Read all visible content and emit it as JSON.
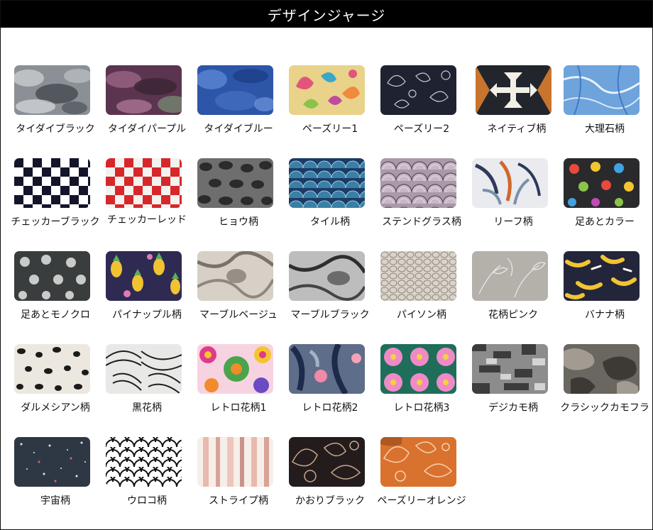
{
  "header": {
    "title": "デザインジャージ"
  },
  "swatches": [
    {
      "label": "タイダイブラック",
      "icon": "tie-dye-black-pattern"
    },
    {
      "label": "タイダイパープル",
      "icon": "tie-dye-purple-pattern"
    },
    {
      "label": "タイダイブルー",
      "icon": "tie-dye-blue-pattern"
    },
    {
      "label": "ペーズリー1",
      "icon": "paisley-1-pattern"
    },
    {
      "label": "ペーズリー2",
      "icon": "paisley-2-pattern"
    },
    {
      "label": "ネイティブ柄",
      "icon": "native-pattern"
    },
    {
      "label": "大理石柄",
      "icon": "marble-blue-pattern"
    },
    {
      "label": "チェッカーブラック",
      "icon": "checker-black-pattern"
    },
    {
      "label": "チェッカーレッド",
      "icon": "checker-red-pattern"
    },
    {
      "label": "ヒョウ柄",
      "icon": "leopard-pattern"
    },
    {
      "label": "タイル柄",
      "icon": "tile-pattern"
    },
    {
      "label": "ステンドグラス柄",
      "icon": "stained-glass-pattern"
    },
    {
      "label": "リーフ柄",
      "icon": "leaf-pattern"
    },
    {
      "label": "足あとカラー",
      "icon": "paw-color-pattern"
    },
    {
      "label": "足あとモノクロ",
      "icon": "paw-mono-pattern"
    },
    {
      "label": "パイナップル柄",
      "icon": "pineapple-pattern"
    },
    {
      "label": "マーブルベージュ",
      "icon": "marble-beige-pattern"
    },
    {
      "label": "マーブルブラック",
      "icon": "marble-black-pattern"
    },
    {
      "label": "パイソン柄",
      "icon": "python-pattern"
    },
    {
      "label": "花柄ピンク",
      "icon": "floral-pink-pattern"
    },
    {
      "label": "バナナ柄",
      "icon": "banana-pattern"
    },
    {
      "label": "ダルメシアン柄",
      "icon": "dalmatian-pattern"
    },
    {
      "label": "黒花柄",
      "icon": "black-floral-pattern"
    },
    {
      "label": "レトロ花柄1",
      "icon": "retro-floral-1-pattern"
    },
    {
      "label": "レトロ花柄2",
      "icon": "retro-floral-2-pattern"
    },
    {
      "label": "レトロ花柄3",
      "icon": "retro-floral-3-pattern"
    },
    {
      "label": "デジカモ柄",
      "icon": "digital-camo-pattern"
    },
    {
      "label": "クラシックカモフラ",
      "icon": "classic-camo-pattern"
    },
    {
      "label": "宇宙柄",
      "icon": "space-pattern"
    },
    {
      "label": "ウロコ柄",
      "icon": "scale-pattern"
    },
    {
      "label": "ストライプ柄",
      "icon": "stripe-pattern"
    },
    {
      "label": "かおりブラック",
      "icon": "kaori-black-pattern"
    },
    {
      "label": "ペーズリーオレンジ",
      "icon": "paisley-orange-pattern"
    }
  ]
}
